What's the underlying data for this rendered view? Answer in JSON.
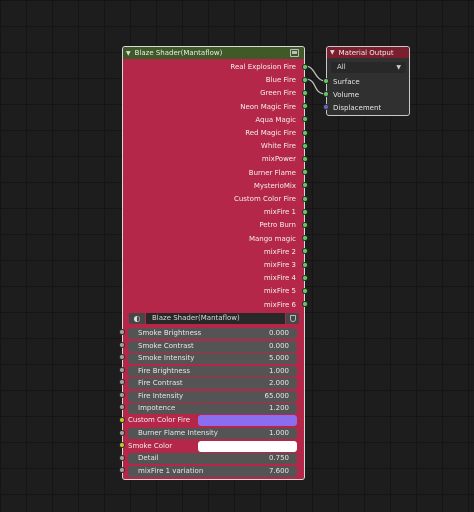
{
  "blaze_node": {
    "title": "Blaze Shader(Mantaflow)",
    "outputs": [
      "Real Explosion Fire",
      "Blue Fire",
      "Green Fire",
      "Neon Magic Fire",
      "Aqua Magic",
      "Red Magic Fire",
      "White Fire",
      "mixPower",
      "Burner Flame",
      "MysterioMix",
      "Custom Color Fire",
      "mixFire 1",
      "Petro Burn",
      "Mango magic",
      "mixFire 2",
      "mixFire 3",
      "mixFire 4",
      "mixFire 5",
      "mixFire 6"
    ],
    "datablock": "Blaze Shader(Mantaflow)",
    "inputs": [
      {
        "label": "Smoke Brightness",
        "value": "0.000"
      },
      {
        "label": "Smoke Contrast",
        "value": "0.000"
      },
      {
        "label": "Smoke Intensity",
        "value": "5.000"
      },
      {
        "label": "Fire Brightness",
        "value": "1.000"
      },
      {
        "label": "Fire Contrast",
        "value": "2.000"
      },
      {
        "label": "Fire Intensity",
        "value": "65.000"
      },
      {
        "label": "Impotence",
        "value": "1.200"
      }
    ],
    "custom_color_fire": {
      "label": "Custom Color Fire",
      "color": "#8b6df0"
    },
    "burner_flame_intensity": {
      "label": "Burner Flame Intensity",
      "value": "1.000"
    },
    "smoke_color": {
      "label": "Smoke Color",
      "color": "#ffffff"
    },
    "detail": {
      "label": "Detail",
      "value": "0.750"
    },
    "mixfire_variation": {
      "label": "mixFire 1 variation",
      "value": "7.600"
    }
  },
  "material_output": {
    "title": "Material Output",
    "target": "All",
    "inputs": [
      "Surface",
      "Volume",
      "Displacement"
    ]
  },
  "colors": {
    "canvas": "#1d1d1d",
    "node_body": "#b52748",
    "header_green": "#3f5a26",
    "header_red": "#7b1f2e",
    "socket_green": "#63c763",
    "socket_grey": "#a1a1a1",
    "socket_yellow": "#c7c729",
    "socket_blue": "#6363c7"
  },
  "icons": [
    "collapse-arrow-icon",
    "node-preview-icon",
    "material-sphere-icon",
    "fake-user-shield-icon",
    "dropdown-chevron-icon"
  ]
}
